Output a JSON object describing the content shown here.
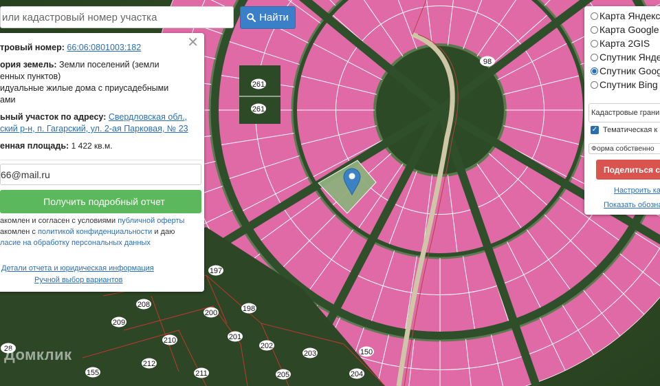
{
  "search": {
    "placeholder": "или кадастровый номер участка",
    "button_label": "Найти",
    "button_icon": "search-icon"
  },
  "info": {
    "cadnum_label": "тровый номер:",
    "cadnum_value": "66:06:0801003:182",
    "category_label": "ория земель:",
    "category_value": "Земли поселений (земли",
    "category_value_2": "енных пунктов)",
    "use_line_1": "идуальные жилые дома с приусадебными",
    "use_line_2": "ами",
    "address_label": "ьный участок по адресу:",
    "address_value_1": "Свердловская обл.,",
    "address_value_2": "ский р-н, п. Гагарский, ул. 2-ая Парковая, № 23",
    "area_label": "енная площадь:",
    "area_value": "1 422 кв.м.",
    "email_value": "66@mail.ru",
    "report_button": "Получить подробный отчет",
    "terms_1_pre": "акомлен и согласен с условиями",
    "terms_1_link": "публичной оферты",
    "terms_2_pre": "акомлен с",
    "terms_2_link": "политикой конфиденциальности",
    "terms_2_post": "и даю",
    "terms_3_link": "ласие на обработку персональных данных",
    "details_link": "Детали отчета и юридическая информация",
    "manual_link": "Ручной выбор вариантов"
  },
  "layers": {
    "options": [
      {
        "label": "Карта Яндекс",
        "selected": false
      },
      {
        "label": "Карта Google",
        "selected": false
      },
      {
        "label": "Карта 2GIS",
        "selected": false
      },
      {
        "label": "Спутник Янде",
        "selected": false
      },
      {
        "label": "Спутник Goog",
        "selected": true
      },
      {
        "label": "Спутник Bing",
        "selected": false
      }
    ],
    "cadastral_select": "Кадастровые грани",
    "thematic_label": "Тематическая к",
    "thematic_checked": true,
    "ownership_select": "Форма собственно",
    "share_button": "Поделиться сс",
    "settings_link": "Настроить кар",
    "show_link": "Показать обозна"
  },
  "map": {
    "lot_labels": [
      "98",
      "261",
      "261",
      "197",
      "208",
      "200",
      "198",
      "209",
      "201",
      "210",
      "202",
      "203",
      "150",
      "212",
      "211",
      "205",
      "204",
      "155",
      "28"
    ],
    "parcel_color": "#e06aa6",
    "selected_parcel_color": "#8fb07d"
  },
  "watermark": "Домклик"
}
